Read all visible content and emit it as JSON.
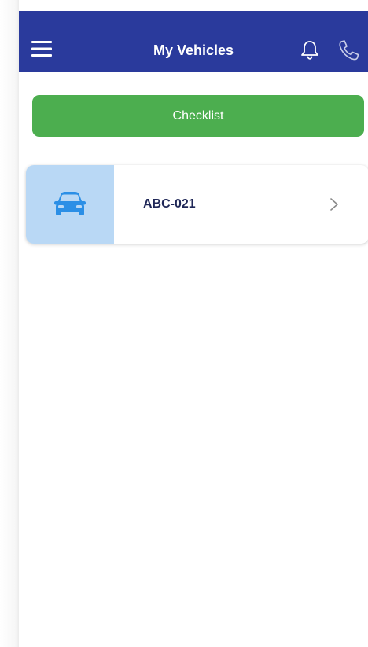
{
  "app_bar": {
    "title": "My Vehicles",
    "background": "#2a3a9c",
    "icons": [
      "menu-icon",
      "bell-icon",
      "phone-icon"
    ]
  },
  "checklist_button": {
    "label": "Checklist",
    "color": "#4cae4f"
  },
  "vehicles": [
    {
      "plate": "ABC-021",
      "icon": "car-icon",
      "thumb_color": "#b9d8f5",
      "icon_color": "#2b8fe6"
    }
  ]
}
